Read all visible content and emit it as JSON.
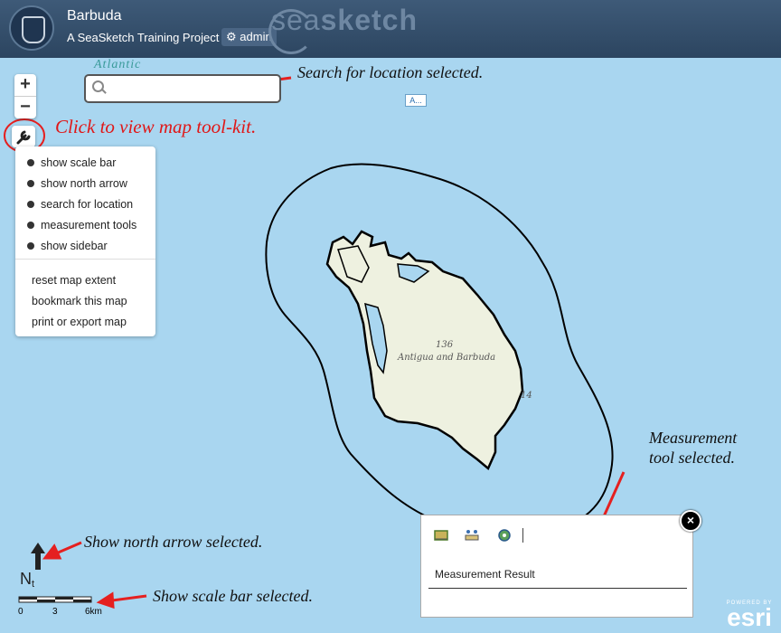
{
  "header": {
    "title": "Barbuda",
    "subtitle": "A SeaSketch Training Project",
    "admin_label": "admin",
    "brand_prefix": "sea",
    "brand_suffix": "sketch"
  },
  "map": {
    "ocean_label": "Atlantic",
    "country_label": "Antigua and Barbuda",
    "elevation_label": "136",
    "small_label": "14",
    "attribution_chip": "A..."
  },
  "zoom": {
    "in_label": "+",
    "out_label": "−"
  },
  "search": {
    "placeholder": "",
    "value": ""
  },
  "tool_menu": {
    "toggles": [
      {
        "label": "show scale bar"
      },
      {
        "label": "show north arrow"
      },
      {
        "label": "search for location"
      },
      {
        "label": "measurement tools"
      },
      {
        "label": "show sidebar"
      }
    ],
    "actions": [
      {
        "label": "reset map extent"
      },
      {
        "label": "bookmark this map"
      },
      {
        "label": "print or export map"
      }
    ]
  },
  "annotations": {
    "search": "Search for location selected.",
    "toolkit": "Click to view map tool-kit.",
    "measurement_1": "Measurement",
    "measurement_2": "tool selected.",
    "north": "Show north arrow selected.",
    "scale": "Show scale bar selected."
  },
  "measurement_panel": {
    "result_label": "Measurement Result",
    "close_label": "×",
    "tools": [
      "area-measure-icon",
      "distance-measure-icon",
      "location-icon"
    ]
  },
  "north_arrow": {
    "letter": "N",
    "sub": "t"
  },
  "scale_bar": {
    "ticks": [
      "0",
      "3",
      "6km"
    ]
  },
  "esri": {
    "powered_by": "POWERED BY",
    "name": "esri"
  },
  "colors": {
    "ocean": "#a9d6f0",
    "header": "#2c4560",
    "annotation_red": "#e01717",
    "arrow_red": "#e52020"
  }
}
